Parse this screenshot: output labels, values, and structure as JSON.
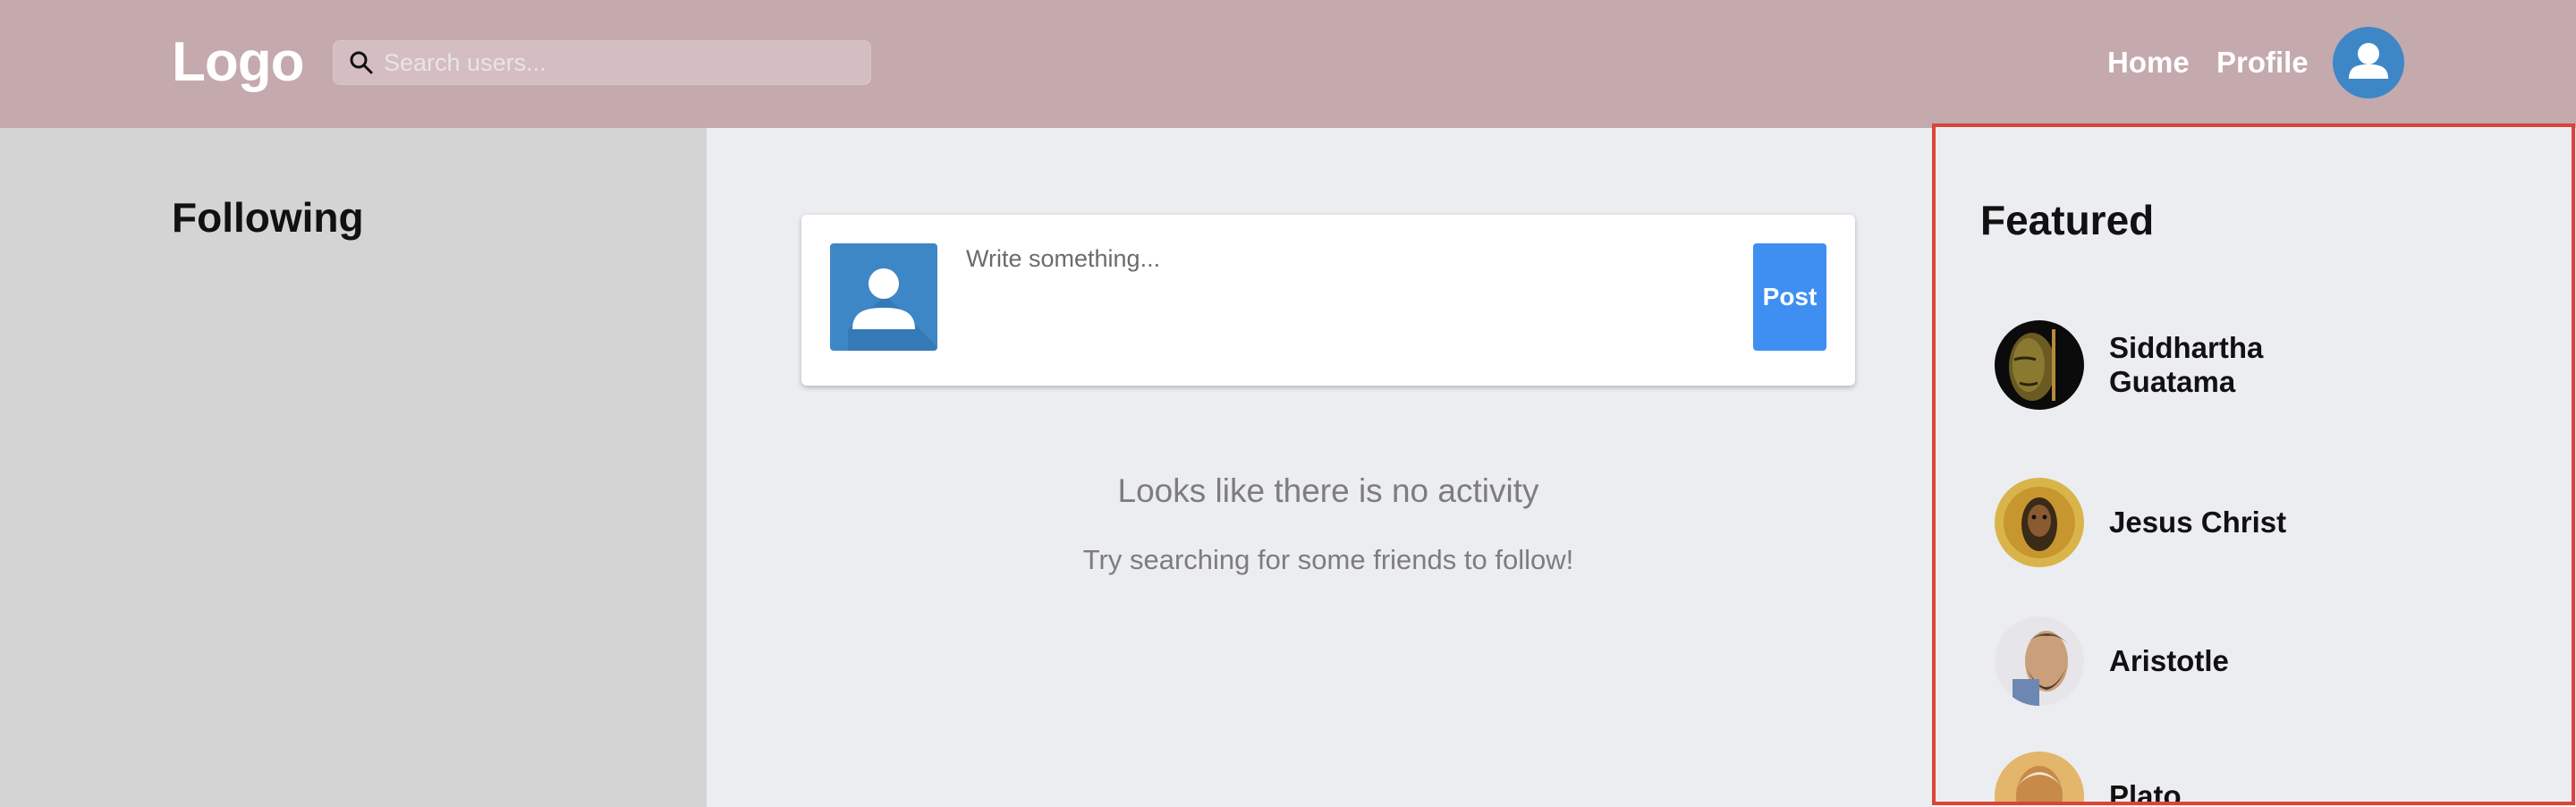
{
  "header": {
    "logo": "Logo",
    "search_placeholder": "Search users...",
    "nav": {
      "home": "Home",
      "profile": "Profile"
    }
  },
  "following": {
    "title": "Following"
  },
  "composer": {
    "placeholder": "Write something...",
    "post_label": "Post"
  },
  "feed": {
    "empty_title": "Looks like there is no activity",
    "empty_subtitle": "Try searching for some friends to follow!"
  },
  "featured": {
    "title": "Featured",
    "users": [
      {
        "name": "Siddhartha Guatama"
      },
      {
        "name": "Jesus Christ"
      },
      {
        "name": "Aristotle"
      },
      {
        "name": "Plato"
      }
    ]
  },
  "colors": {
    "header_bg": "#c4a9ad",
    "sidebar_bg": "#d4d4d5",
    "main_bg": "#ecedf0",
    "accent": "#3e8ff1",
    "avatar_blue": "#3d87c7",
    "highlight_border": "#d9453a"
  }
}
